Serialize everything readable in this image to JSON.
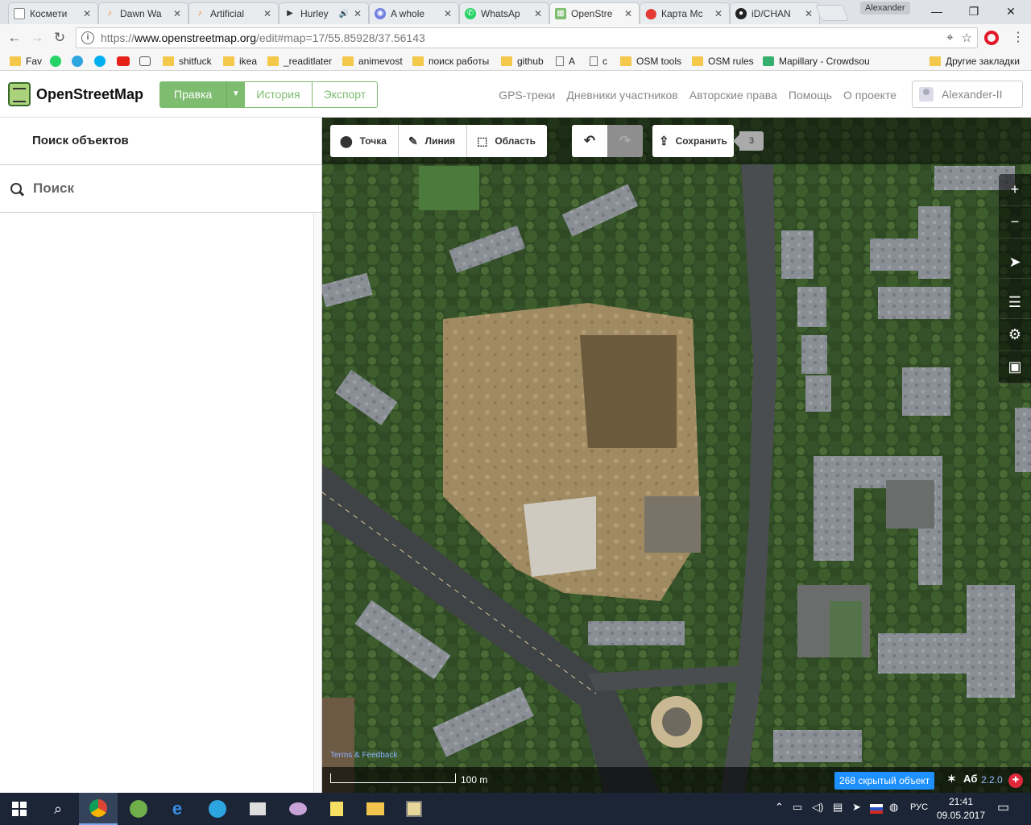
{
  "browser": {
    "tabs": [
      {
        "title": "Космети",
        "icon": "page-icon",
        "color": "#ffffff"
      },
      {
        "title": "Dawn Wa",
        "icon": "music-icon",
        "color": "#f47b20"
      },
      {
        "title": "Artificial",
        "icon": "music-icon",
        "color": "#f47b20"
      },
      {
        "title": "Hurley",
        "icon": "play-icon",
        "color": "#333333"
      },
      {
        "title": "A whole",
        "icon": "discord-icon",
        "color": "#6d7fe0"
      },
      {
        "title": "WhatsAp",
        "icon": "whatsapp-icon",
        "color": "#25d366"
      },
      {
        "title": "OpenStre",
        "icon": "osm-icon",
        "color": "#7ebc6f"
      },
      {
        "title": "Карта Мс",
        "icon": "map-pin-icon",
        "color": "#e53935"
      },
      {
        "title": "iD/CHAN",
        "icon": "github-icon",
        "color": "#222222"
      }
    ],
    "profile_name": "Alexander",
    "url": {
      "scheme": "https://",
      "host": "www.openstreetmap.org",
      "path": "/edit#map=17/55.85928/37.56143"
    },
    "bookmarks": [
      {
        "label": "Fav",
        "icon": "folder-icon"
      },
      {
        "label": "",
        "icon": "whatsapp-icon"
      },
      {
        "label": "",
        "icon": "telegram-icon"
      },
      {
        "label": "",
        "icon": "skype-icon"
      },
      {
        "label": "",
        "icon": "youtube-icon"
      },
      {
        "label": "",
        "icon": "robot-icon"
      },
      {
        "label": "shitfuck",
        "icon": "folder-icon"
      },
      {
        "label": "ikea",
        "icon": "folder-icon"
      },
      {
        "label": "_readitlater",
        "icon": "folder-icon"
      },
      {
        "label": "animevost",
        "icon": "folder-icon"
      },
      {
        "label": "поиск работы",
        "icon": "folder-icon"
      },
      {
        "label": "github",
        "icon": "folder-icon"
      },
      {
        "label": "A",
        "icon": "page-icon"
      },
      {
        "label": "c",
        "icon": "page-icon"
      },
      {
        "label": "OSM tools",
        "icon": "folder-icon"
      },
      {
        "label": "OSM rules",
        "icon": "folder-icon"
      },
      {
        "label": "Mapillary - Crowdsou",
        "icon": "mapillary-icon"
      }
    ],
    "other_bookmarks": "Другие закладки"
  },
  "osm": {
    "brand": "OpenStreetMap",
    "edit_label": "Правка",
    "history_label": "История",
    "export_label": "Экспорт",
    "nav": [
      "GPS-треки",
      "Дневники участников",
      "Авторские права",
      "Помощь",
      "О проекте"
    ],
    "user": "Alexander-II",
    "accent": "#7ebc6f"
  },
  "sidebar": {
    "title": "Поиск объектов",
    "search_placeholder": "Поиск"
  },
  "editor": {
    "modes": [
      "Точка",
      "Линия",
      "Область"
    ],
    "save_label": "Сохранить",
    "edit_count": "3",
    "attribution": "Terms & Feedback",
    "scale_label": "100 m",
    "hidden_features": "268 скрытый объект",
    "version": "2.2.0",
    "badge_color": "#1e90ff"
  },
  "taskbar": {
    "language": "РУС",
    "time": "21:41",
    "date": "09.05.2017"
  }
}
